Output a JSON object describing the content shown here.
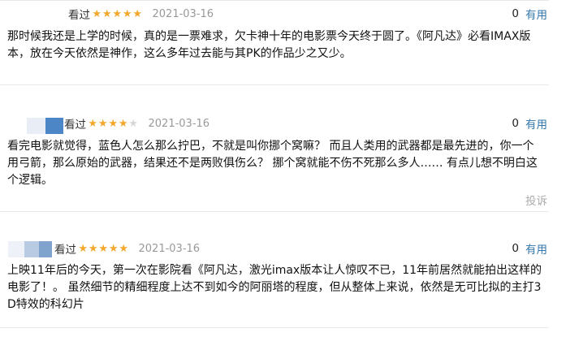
{
  "reviews": [
    {
      "rated_label": "看过",
      "stars": 5,
      "date": "2021-03-16",
      "useful_count": "0",
      "useful_label": "有用",
      "comment": "那时候我还是上学的时候，真的是一票难求，欠卡神十年的电影票今天终于圆了。《阿凡达》必看IMAX版本，放在今天依然是神作，这么多年过去能与其PK的作品少之又少。"
    },
    {
      "rated_label": "看过",
      "stars": 4,
      "date": "2021-03-16",
      "useful_count": "0",
      "useful_label": "有用",
      "comment": "看完电影就觉得，蓝色人怎么那么拧巴，不就是叫你挪个窝嘛？ 而且人类用的武器都是最先进的，你一个用弓箭，那么原始的武器，结果还不是两败俱伤么？ 挪个窝就能不伤不死那么多人…… 有点儿想不明白这个逻辑。",
      "report_label": "投诉"
    },
    {
      "rated_label": "看过",
      "stars": 5,
      "date": "2021-03-16",
      "useful_count": "0",
      "useful_label": "有用",
      "comment": "上映11年后的今天，第一次在影院看《阿凡达，激光imax版本让人惊叹不已，11年前居然就能拍出这样的电影了！。 虽然细节的精细程度上达不到如今的阿丽塔的程度，但从整体上来说，依然是无可比拟的主打3D特效的科幻片"
    }
  ],
  "colors": {
    "star": "#f4a72b",
    "star_empty": "#d6d6d6",
    "link": "#3377aa",
    "date": "#999999",
    "report": "#aaaaaa"
  }
}
